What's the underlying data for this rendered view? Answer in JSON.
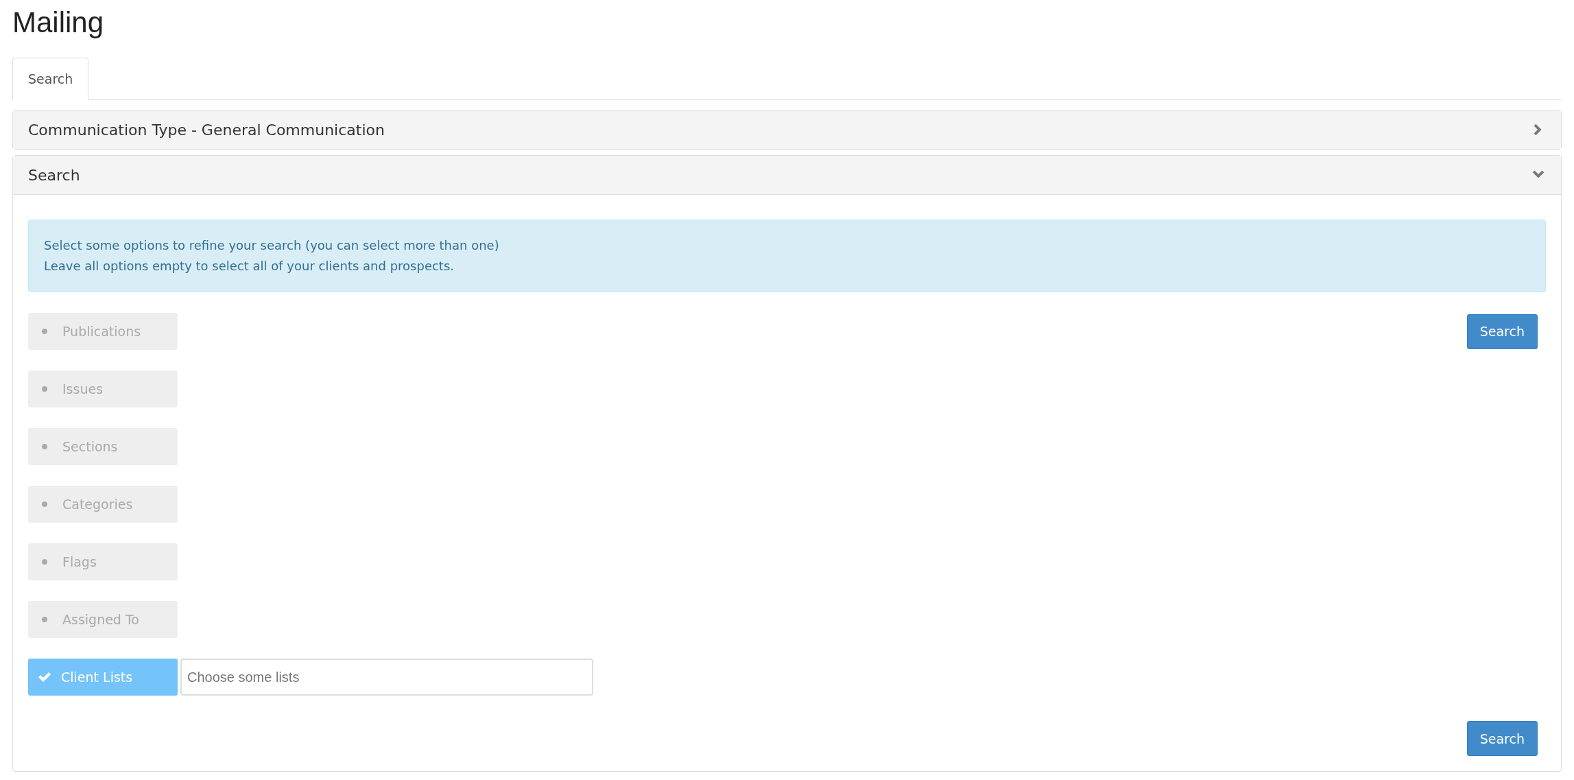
{
  "page_title": "Mailing",
  "tabs": [
    {
      "label": "Search",
      "selected": true
    }
  ],
  "panels": [
    {
      "title": "Communication Type - General Communication",
      "expanded": false
    },
    {
      "title": "Search",
      "expanded": true,
      "alert": [
        "Select some options to refine your search (you can select more than one)",
        "Leave all options empty to select all of your clients and prospects."
      ],
      "options": [
        {
          "label": "Publications",
          "checked": false
        },
        {
          "label": "Issues",
          "checked": false
        },
        {
          "label": "Sections",
          "checked": false
        },
        {
          "label": "Categories",
          "checked": false
        },
        {
          "label": "Flags",
          "checked": false
        },
        {
          "label": "Assigned To",
          "checked": false
        },
        {
          "label": "Client Lists",
          "checked": true,
          "placeholder": "Choose some lists"
        }
      ],
      "top_button": "Search",
      "bottom_button": "Search"
    }
  ]
}
